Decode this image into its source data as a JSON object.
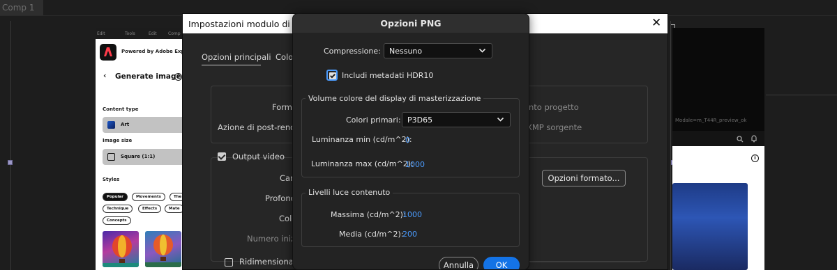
{
  "background": {
    "comp_tab": "Comp 1"
  },
  "express_panel": {
    "menu": [
      "Edit",
      "Tools",
      "Edit",
      "Comp"
    ],
    "powered_by": "Powered by Adobe Express",
    "back_glyph": "‹",
    "title": "Generate image",
    "info_glyph": "i",
    "content_type_label": "Content type",
    "content_type_value": "Art",
    "image_size_label": "Image size",
    "image_size_value": "Square (1:1)",
    "styles_label": "Styles",
    "style_chips_row1": [
      "Popular",
      "Movements",
      "The"
    ],
    "style_chips_row2": [
      "Technique",
      "Effects",
      "Mate"
    ],
    "style_chips_row3": [
      "Concepts"
    ]
  },
  "right_panel": {
    "small_text": "Modale=m_T44R_preview_ok",
    "info_glyph": "i"
  },
  "output_module_dialog": {
    "title": "Impostazioni modulo di output",
    "close_glyph": "✕",
    "tabs": [
      {
        "label": "Opzioni principali",
        "active": true
      },
      {
        "label": "Colore",
        "active": false
      }
    ],
    "format_label": "Formato:",
    "post_render_label": "Azione di post-rendering:",
    "right_text_1": "nto progetto",
    "right_text_2": "XMP sorgente",
    "output_video_label": "Output video",
    "output_video_checked": true,
    "channels_label": "Canali:",
    "depth_label": "Profondità:",
    "color_label": "Colore:",
    "start_number_label": "Numero iniziale:",
    "format_options_button": "Opzioni formato...",
    "resize_label": "Ridimensiona",
    "resize_checked": false
  },
  "png_dialog": {
    "title": "Opzioni PNG",
    "compression_label": "Compressione:",
    "compression_value": "Nessuno",
    "hdr10_label": "Includi metadati HDR10",
    "hdr10_checked": true,
    "mastering_group_title": "Volume colore del display di masterizzazione",
    "primaries_label": "Colori primari:",
    "primaries_value": "P3D65",
    "lum_min_label": "Luminanza min (cd/m^2):",
    "lum_min_value": "0",
    "lum_max_label": "Luminanza max (cd/m^2):",
    "lum_max_value": "1000",
    "content_light_group_title": "Livelli luce contenuto",
    "max_label": "Massima (cd/m^2):",
    "max_value": "1000",
    "avg_label": "Media (cd/m^2):",
    "avg_value": "200",
    "cancel_button": "Annulla",
    "ok_button": "OK"
  },
  "colors": {
    "accent_blue": "#1473e6",
    "value_blue": "#4b9cff",
    "dialog_bg": "#232323",
    "handle_purple": "#9c98c6"
  },
  "icons": [
    "chevron-down-icon",
    "close-icon",
    "checkbox-checked-icon",
    "adobe-express-logo-icon",
    "info-icon",
    "back-chevron-icon"
  ]
}
